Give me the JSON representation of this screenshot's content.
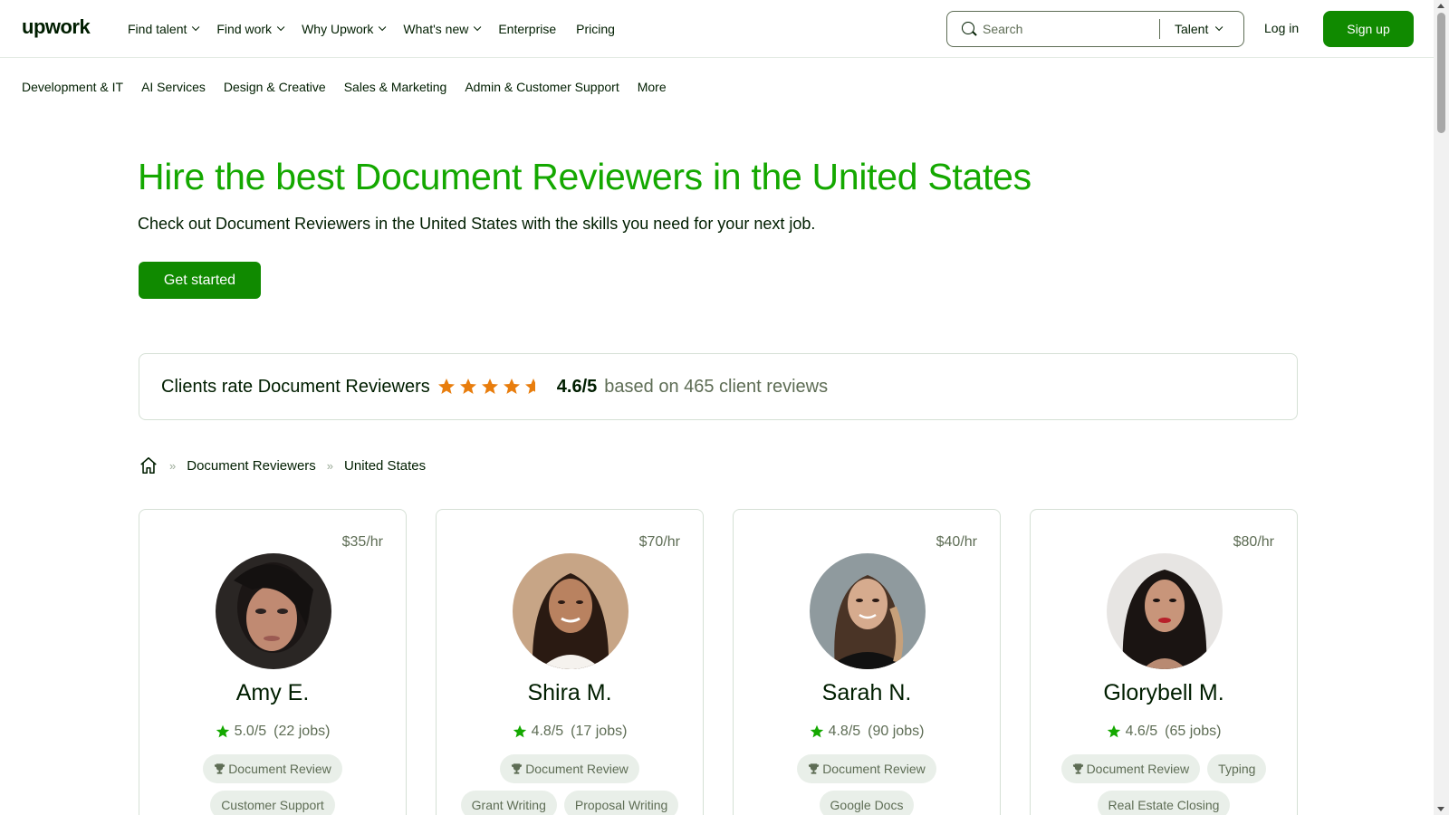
{
  "header": {
    "logo": "upwork",
    "nav": [
      "Find talent",
      "Find work",
      "Why Upwork",
      "What's new",
      "Enterprise",
      "Pricing"
    ],
    "nav_has_dropdown": [
      true,
      true,
      true,
      true,
      false,
      false
    ],
    "search_placeholder": "Search",
    "search_scope": "Talent",
    "login": "Log in",
    "signup": "Sign up"
  },
  "categories": [
    "Development & IT",
    "AI Services",
    "Design & Creative",
    "Sales & Marketing",
    "Admin & Customer Support",
    "More"
  ],
  "hero": {
    "title": "Hire the best Document Reviewers in the United States",
    "subtitle": "Check out Document Reviewers in the United States with the skills you need for your next job.",
    "cta": "Get started"
  },
  "rating": {
    "label": "Clients rate Document Reviewers",
    "score": "4.6/5",
    "stars_value": 4.6,
    "reviews": "based on 465 client reviews"
  },
  "breadcrumb": {
    "link": "Document Reviewers",
    "current": "United States"
  },
  "freelancers": [
    {
      "rate": "$35/hr",
      "name": "Amy E.",
      "score": "5.0/5",
      "jobs": "(22 jobs)",
      "skills": [
        "Document Review",
        "Customer Support"
      ]
    },
    {
      "rate": "$70/hr",
      "name": "Shira M.",
      "score": "4.8/5",
      "jobs": "(17 jobs)",
      "skills": [
        "Document Review",
        "Grant Writing",
        "Proposal Writing"
      ]
    },
    {
      "rate": "$40/hr",
      "name": "Sarah N.",
      "score": "4.8/5",
      "jobs": "(90 jobs)",
      "skills": [
        "Document Review",
        "Google Docs"
      ]
    },
    {
      "rate": "$80/hr",
      "name": "Glorybell M.",
      "score": "4.6/5",
      "jobs": "(65 jobs)",
      "skills": [
        "Document Review",
        "Typing",
        "Real Estate Closing"
      ]
    }
  ],
  "colors": {
    "brand_green": "#14a800",
    "button_green": "#108a00",
    "star_orange": "#e87d0d",
    "text_dark": "#001e00",
    "text_muted": "#5e6d55"
  }
}
